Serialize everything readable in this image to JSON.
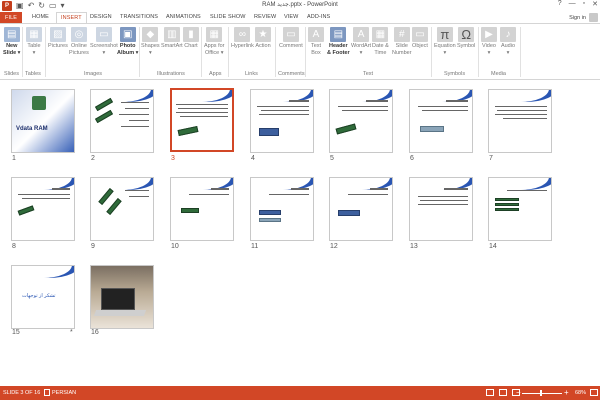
{
  "titlebar": {
    "title": "RAM جدید.pptx - PowerPoint",
    "help": "?",
    "minimize": "—",
    "restore": "▫",
    "close": "✕"
  },
  "tabs": [
    {
      "label": "FILE"
    },
    {
      "label": "HOME"
    },
    {
      "label": "INSERT"
    },
    {
      "label": "DESIGN"
    },
    {
      "label": "TRANSITIONS"
    },
    {
      "label": "ANIMATIONS"
    },
    {
      "label": "SLIDE SHOW"
    },
    {
      "label": "REVIEW"
    },
    {
      "label": "VIEW"
    },
    {
      "label": "ADD-INS"
    }
  ],
  "account": {
    "signin": "Sign in"
  },
  "ribbon": {
    "buttons": [
      {
        "label": "New\nSlide ▾",
        "icon": "new-slide-icon",
        "color": "#9fb6d6"
      },
      {
        "label": "Table\n▾",
        "icon": "table-icon",
        "color": "#cdd6e2"
      },
      {
        "label": "Pictures",
        "icon": "pictures-icon",
        "color": "#cdd6e2"
      },
      {
        "label": "Online\nPictures",
        "icon": "online-pictures-icon",
        "color": "#cdd6e2"
      },
      {
        "label": "Screenshot\n▾",
        "icon": "screenshot-icon",
        "color": "#cdd6e2"
      },
      {
        "label": "Photo\nAlbum ▾",
        "icon": "photo-album-icon",
        "color": "#7d97c0"
      },
      {
        "label": "Shapes\n▾",
        "icon": "shapes-icon",
        "color": "#d3d3d3"
      },
      {
        "label": "SmartArt",
        "icon": "smartart-icon",
        "color": "#d3d3d3"
      },
      {
        "label": "Chart",
        "icon": "chart-icon",
        "color": "#d3d3d3"
      },
      {
        "label": "Apps for\nOffice ▾",
        "icon": "apps-icon",
        "color": "#d3d3d3"
      },
      {
        "label": "Hyperlink",
        "icon": "hyperlink-icon",
        "color": "#d3d3d3"
      },
      {
        "label": "Action",
        "icon": "action-icon",
        "color": "#d3d3d3"
      },
      {
        "label": "Comment",
        "icon": "comment-icon",
        "color": "#d3d3d3"
      },
      {
        "label": "Text\nBox",
        "icon": "text-box-icon",
        "color": "#d3d3d3"
      },
      {
        "label": "Header\n& Footer",
        "icon": "header-footer-icon",
        "color": "#7d97c0"
      },
      {
        "label": "WordArt\n▾",
        "icon": "wordart-icon",
        "color": "#d3d3d3"
      },
      {
        "label": "Date &\nTime",
        "icon": "date-time-icon",
        "color": "#d3d3d3"
      },
      {
        "label": "Slide\nNumber",
        "icon": "slide-number-icon",
        "color": "#d3d3d3"
      },
      {
        "label": "Object",
        "icon": "object-icon",
        "color": "#d3d3d3"
      },
      {
        "label": "Equation\n▾",
        "icon": "equation-icon",
        "color": "#d3d3d3"
      },
      {
        "label": "Symbol",
        "icon": "symbol-icon",
        "color": "#d3d3d3"
      },
      {
        "label": "Video\n▾",
        "icon": "video-icon",
        "color": "#d3d3d3"
      },
      {
        "label": "Audio\n▾",
        "icon": "audio-icon",
        "color": "#d3d3d3"
      }
    ],
    "groups": [
      "Slides",
      "Tables",
      "Images",
      "Illustrations",
      "Apps",
      "Links",
      "Comments",
      "Text",
      "Symbols",
      "Media"
    ]
  },
  "slides": [
    {
      "number": "1",
      "title": "Vdata RAM"
    },
    {
      "number": "2"
    },
    {
      "number": "3"
    },
    {
      "number": "4"
    },
    {
      "number": "5"
    },
    {
      "number": "6"
    },
    {
      "number": "7"
    },
    {
      "number": "8"
    },
    {
      "number": "9"
    },
    {
      "number": "10"
    },
    {
      "number": "11"
    },
    {
      "number": "12"
    },
    {
      "number": "13"
    },
    {
      "number": "14"
    },
    {
      "number": "15",
      "title": "تشکر از توجهات",
      "star": "*"
    },
    {
      "number": "16"
    }
  ],
  "selected_slide": "3",
  "statusbar": {
    "slide_info": "SLIDE 3 OF 16",
    "language": "PERSIAN",
    "zoom": "68%",
    "minus": "−",
    "plus": "+"
  },
  "colors": {
    "accent": "#d24726",
    "slide_blue": "#2a56b3"
  }
}
